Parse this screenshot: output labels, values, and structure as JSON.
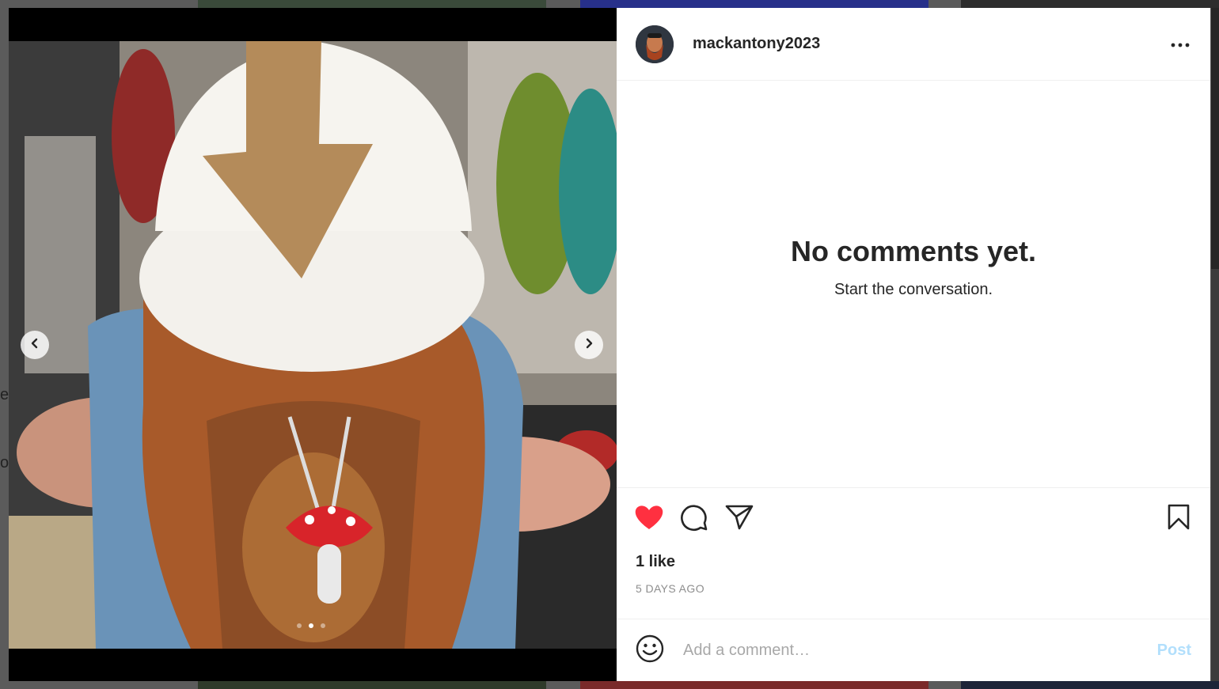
{
  "backdrop": {
    "fragment_1": "es",
    "fragment_2": "o"
  },
  "post": {
    "username": "mackantony2023",
    "image_count": 3,
    "active_image": 2
  },
  "comments": {
    "empty_title": "No comments yet.",
    "empty_subtitle": "Start the conversation."
  },
  "engagement": {
    "likes_label": "1 like",
    "liked": true,
    "like_color": "#ff3040",
    "timestamp": "5 DAYS AGO"
  },
  "comment_form": {
    "placeholder": "Add a comment…",
    "post_label": "Post",
    "post_color": "#b2dffc"
  },
  "icons": {
    "prev": "chevron-left-icon",
    "next": "chevron-right-icon",
    "more": "more-horizontal-icon",
    "like": "heart-icon",
    "comment": "comment-icon",
    "share": "share-icon",
    "save": "bookmark-icon",
    "emoji": "emoji-icon"
  }
}
